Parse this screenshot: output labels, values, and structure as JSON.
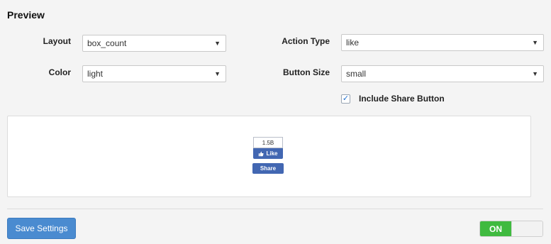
{
  "page": {
    "heading": "Preview"
  },
  "form": {
    "layout": {
      "label": "Layout",
      "value": "box_count"
    },
    "action_type": {
      "label": "Action Type",
      "value": "like"
    },
    "color": {
      "label": "Color",
      "value": "light"
    },
    "button_size": {
      "label": "Button Size",
      "value": "small"
    },
    "include_share": {
      "label": "Include Share Button",
      "checked": true
    }
  },
  "preview": {
    "count": "1.5B",
    "like_label": "Like",
    "share_label": "Share"
  },
  "footer": {
    "save_label": "Save Settings",
    "toggle_label": "ON"
  },
  "colors": {
    "facebook_blue": "#4267b2",
    "save_button": "#4a8bd0",
    "toggle_on": "#3fba3f"
  },
  "icons": {
    "select_arrow": "chevron-down-icon",
    "check": "checkmark-icon",
    "like": "thumbs-up-icon"
  }
}
